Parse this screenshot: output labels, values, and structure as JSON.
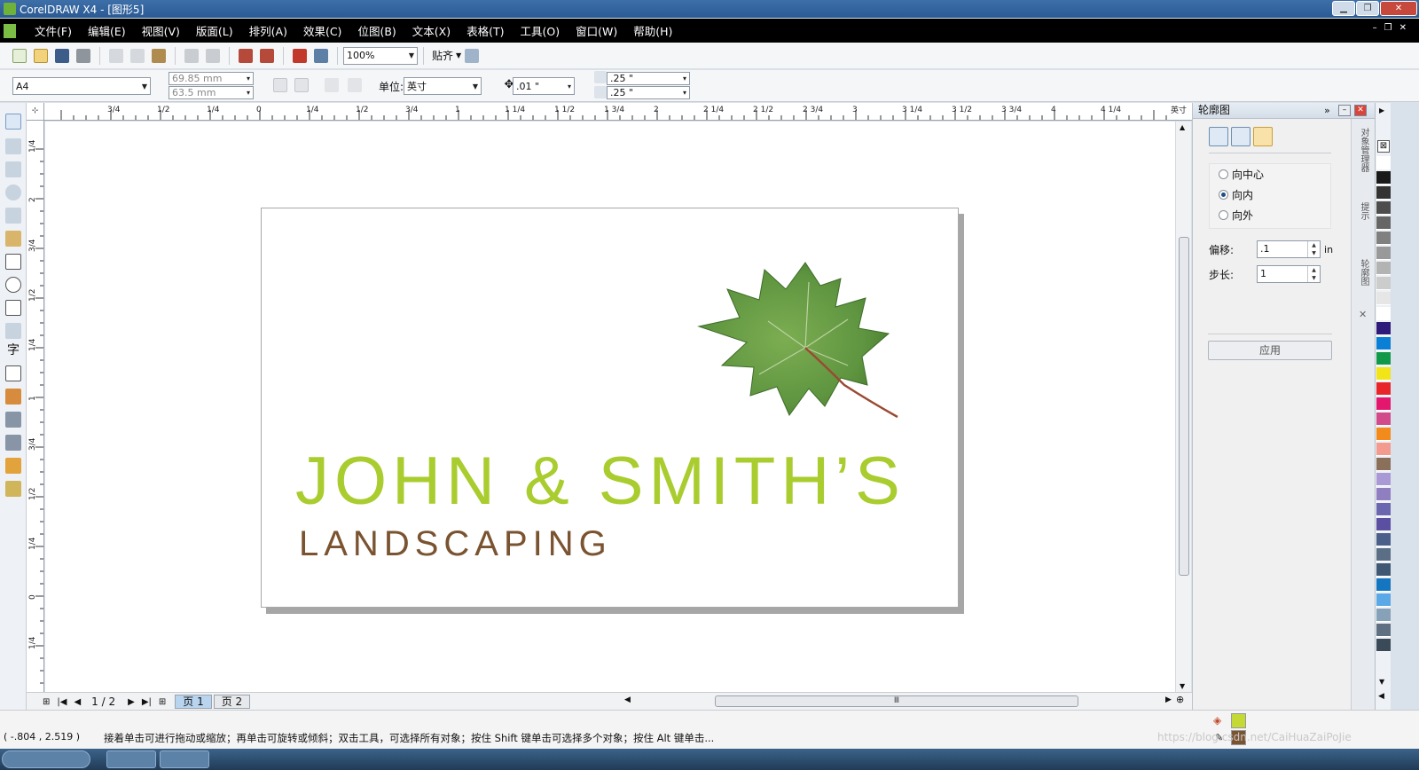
{
  "window": {
    "title": "CorelDRAW X4 - [图形5]"
  },
  "menu": {
    "items": [
      "文件(F)",
      "编辑(E)",
      "视图(V)",
      "版面(L)",
      "排列(A)",
      "效果(C)",
      "位图(B)",
      "文本(X)",
      "表格(T)",
      "工具(O)",
      "窗口(W)",
      "帮助(H)"
    ]
  },
  "toolbar": {
    "zoom": "100%",
    "snap_label": "贴齐"
  },
  "property_bar": {
    "page_size": "A4",
    "width": "69.85 mm",
    "height": "63.5 mm",
    "unit_label": "单位:",
    "unit_value": "英寸",
    "nudge": ".01 \"",
    "dup_x": ".25 \"",
    "dup_y": ".25 \""
  },
  "rulers": {
    "horizontal": [
      "3/4",
      "1/2",
      "1/4",
      "0",
      "1/4",
      "1/2",
      "3/4",
      "1",
      "1 1/4",
      "1 1/2",
      "1 3/4",
      "2",
      "2 1/4",
      "2 1/2",
      "2 3/4",
      "3",
      "3 1/4",
      "3 1/2",
      "3 3/4",
      "4",
      "4 1/4"
    ],
    "unit": "英寸",
    "vertical": [
      "1/4",
      "2",
      "3/4",
      "1/2",
      "1/4",
      "1",
      "3/4",
      "1/2",
      "1/4",
      "0",
      "1/4"
    ]
  },
  "document": {
    "logo_main": "JOHN & SMITH’S",
    "logo_sub": "LANDSCAPING"
  },
  "pages": {
    "counter": "1 / 2",
    "tabs": [
      "页 1",
      "页 2"
    ]
  },
  "docker": {
    "title": "轮廓图",
    "options": [
      "向中心",
      "向内",
      "向外"
    ],
    "selected_option": "向内",
    "offset_label": "偏移:",
    "offset_value": ".1",
    "offset_unit": "in",
    "steps_label": "步长:",
    "steps_value": "1",
    "apply_label": "应用",
    "side_tabs": [
      "对象管理器",
      "提示",
      "轮廓图"
    ]
  },
  "palette": {
    "colors": [
      "#ffffff",
      "#1a1a1a",
      "#333333",
      "#4d4d4d",
      "#666666",
      "#808080",
      "#999999",
      "#b3b3b3",
      "#cccccc",
      "#e6e6e6",
      "#ffffff",
      "#2e1a7a",
      "#0a7fd6",
      "#11994a",
      "#f1e418",
      "#e8262a",
      "#e3176e",
      "#d24a8a",
      "#f28b1c",
      "#f39b8f",
      "#8a6f5a",
      "#a99ad6",
      "#8f7fc0",
      "#6b66b0",
      "#5a4fa0",
      "#4b5f8a",
      "#5a6e86",
      "#3f5873",
      "#1475c0",
      "#5aa9e6",
      "#87a2b8",
      "#5e7081",
      "#3b4a58"
    ]
  },
  "status": {
    "coords": "( -.804 , 2.519 )",
    "hint": "接着单击可进行拖动或缩放；再单击可旋转或倾斜；双击工具，可选择所有对象；按住 Shift 键单击可选择多个对象；按住 Alt 键单击...",
    "watermark": "https://blog.csdn.net/CaiHuaZaiPoJie"
  },
  "colors": {
    "logo_green": "#a9cc2e",
    "logo_brown": "#7a5330",
    "accent_blue": "#2b5a93"
  }
}
